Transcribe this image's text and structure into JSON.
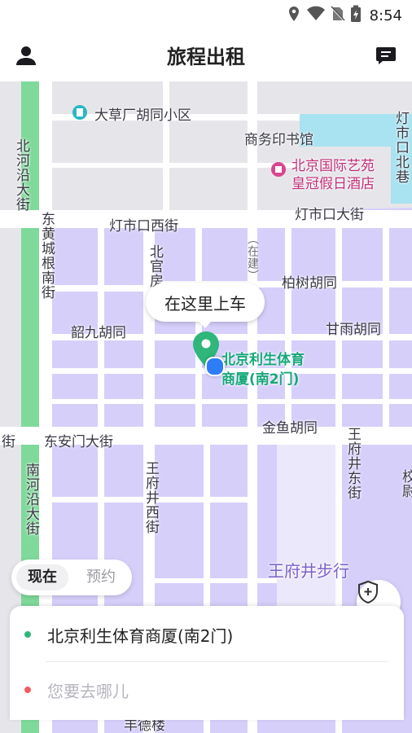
{
  "status_bar": {
    "time": "8:54",
    "icons": [
      "location-icon",
      "wifi-icon",
      "no-sim-icon",
      "battery-charging-icon"
    ]
  },
  "header": {
    "title": "旅程出租",
    "left_icon": "profile-icon",
    "right_icon": "message-icon"
  },
  "map": {
    "labels": {
      "dacaochang": "大草厂胡同小区",
      "shangwu": "商务印书馆",
      "hotel_line1": "北京国际艺苑",
      "hotel_line2": "皇冠假日酒店",
      "dengshikou_beixiang": "灯市口北巷",
      "beiheyan": "北河沿大街",
      "dongchenggen": "东黄城根南街",
      "dengshikou_xijie": "灯市口西街",
      "dengshikou_dajie": "灯市口大街",
      "beiguanfang": "北官房",
      "zaijian": "（在建）",
      "baishu": "柏树胡同",
      "shaojiu": "韶九胡同",
      "ganyu": "甘雨胡同",
      "sports_line1": "北京利生体育",
      "sports_line2": "商厦(南2门)",
      "jinyu": "金鱼胡同",
      "donganmen": "东安门大街",
      "jie_left": "街",
      "nanheyan": "南河沿大街",
      "wangfujing_xijie": "王府井西街",
      "wangfujing_dongjie": "王府井东街",
      "wangfujing_buxing": "王府井步行",
      "xiaowei": "校尉",
      "fengde": "丰德楼"
    },
    "pickup_bubble": "在这里上车"
  },
  "controls": {
    "shield_icon": "safety-shield-icon",
    "locate_icon": "locate-icon"
  },
  "time_tabs": {
    "now": "现在",
    "reserve": "预约"
  },
  "address": {
    "start": "北京利生体育商厦(南2门)",
    "destination_placeholder": "您要去哪儿"
  },
  "colors": {
    "accent_green": "#2fb67a",
    "dest_red": "#f25c62",
    "map_purple": "#d6cffa",
    "road_white": "#ffffff",
    "park_green": "#7fd99a",
    "water_blue": "#a9e2f0"
  }
}
